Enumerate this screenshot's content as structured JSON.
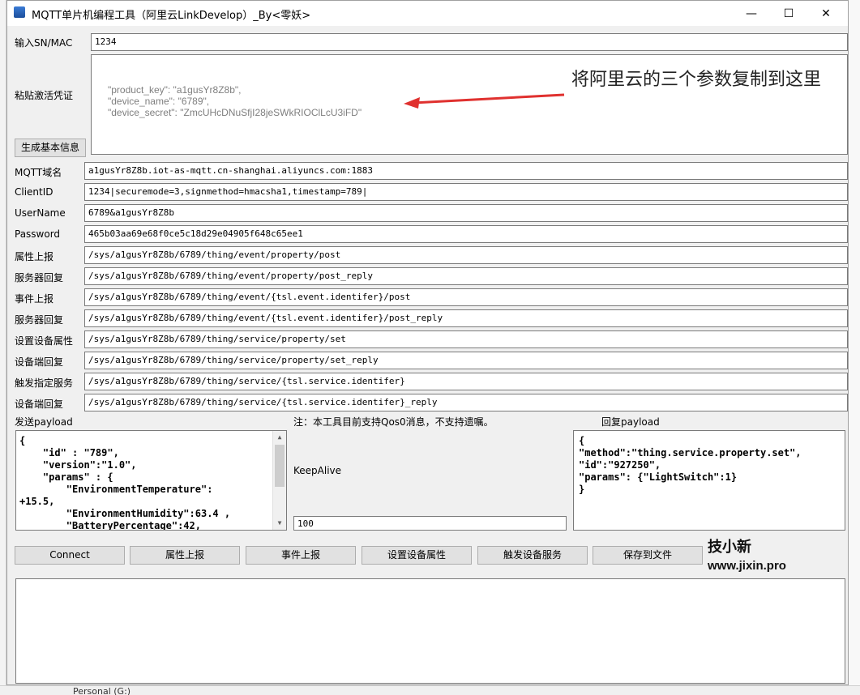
{
  "title": "MQTT单片机编程工具（阿里云LinkDevelop）_By<零妖>",
  "window_controls": {
    "minimize": "—",
    "maximize": "☐",
    "close": "✕"
  },
  "sn": {
    "label": "输入SN/MAC",
    "value": "1234"
  },
  "credentials": {
    "label": "粘贴激活凭证",
    "lines": [
      "\"product_key\": \"a1gusYr8Z8b\",",
      "\"device_name\": \"6789\",",
      "\"device_secret\": \"ZmcUHcDNuSfjI28jeSWkRIOClLcU3iFD\""
    ],
    "annotation": "将阿里云的三个参数复制到这里",
    "arrow_color": "#e0312f"
  },
  "generate_button": "生成基本信息",
  "fields": [
    {
      "label": "MQTT域名",
      "value": "a1gusYr8Z8b.iot-as-mqtt.cn-shanghai.aliyuncs.com:1883"
    },
    {
      "label": "ClientID",
      "value": "1234|securemode=3,signmethod=hmacsha1,timestamp=789|"
    },
    {
      "label": "UserName",
      "value": "6789&a1gusYr8Z8b"
    },
    {
      "label": "Password",
      "value": "465b03aa69e68f0ce5c18d29e04905f648c65ee1"
    },
    {
      "label": "属性上报",
      "value": "/sys/a1gusYr8Z8b/6789/thing/event/property/post"
    },
    {
      "label": "服务器回复",
      "value": "/sys/a1gusYr8Z8b/6789/thing/event/property/post_reply"
    },
    {
      "label": "事件上报",
      "value": "/sys/a1gusYr8Z8b/6789/thing/event/{tsl.event.identifer}/post"
    },
    {
      "label": "服务器回复",
      "value": "/sys/a1gusYr8Z8b/6789/thing/event/{tsl.event.identifer}/post_reply"
    },
    {
      "label": "设置设备属性",
      "value": "/sys/a1gusYr8Z8b/6789/thing/service/property/set"
    },
    {
      "label": "设备端回复",
      "value": "/sys/a1gusYr8Z8b/6789/thing/service/property/set_reply"
    },
    {
      "label": "触发指定服务",
      "value": "/sys/a1gusYr8Z8b/6789/thing/service/{tsl.service.identifer}"
    },
    {
      "label": "设备端回复",
      "value": "/sys/a1gusYr8Z8b/6789/thing/service/{tsl.service.identifer}_reply"
    }
  ],
  "send_payload": {
    "label": "发送payload",
    "lines": [
      "{",
      "    \"id\" : \"789\",",
      "    \"version\":\"1.0\",",
      "    \"params\" : {",
      "        \"EnvironmentTemperature\":",
      "+15.5,",
      "        \"EnvironmentHumidity\":63.4 ,",
      "        \"BatteryPercentage\":42,"
    ]
  },
  "note": "注：本工具目前支持Qos0消息，不支持遗嘱。",
  "keepalive": {
    "label": "KeepAlive",
    "value": "100"
  },
  "reply_payload": {
    "label": "回复payload",
    "lines": [
      "{",
      "\"method\":\"thing.service.property.set\",",
      "\"id\":\"927250\",",
      "\"params\": {\"LightSwitch\":1}",
      "}"
    ]
  },
  "buttons": [
    "Connect",
    "属性上报",
    "事件上报",
    "设置设备属性",
    "触发设备服务",
    "保存到文件"
  ],
  "brand": {
    "cn": "技小新",
    "url": "www.jixin.pro"
  },
  "background": {
    "bottom_text": "Personal (G:)"
  }
}
